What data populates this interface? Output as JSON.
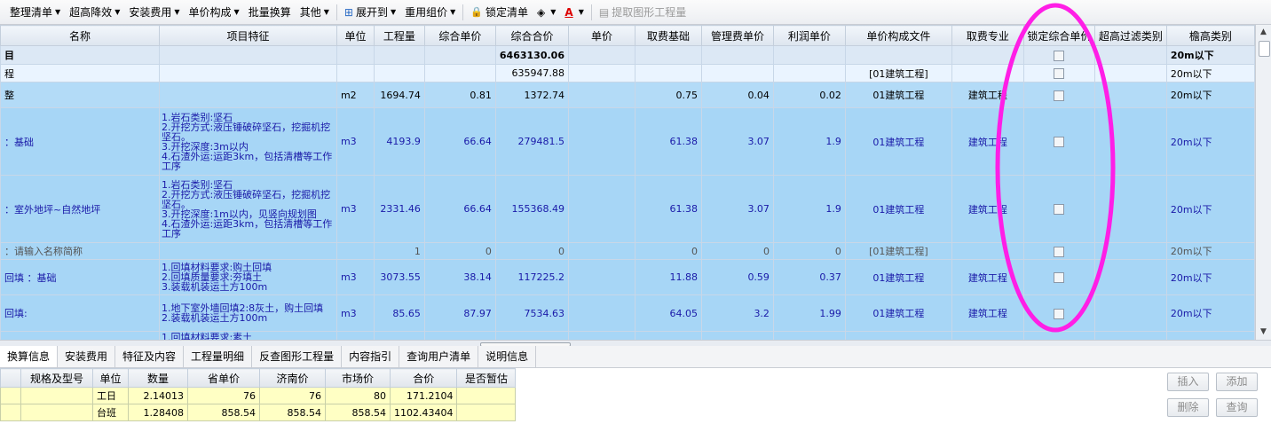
{
  "toolbar": {
    "items": [
      {
        "label": "整理清单",
        "caret": true
      },
      {
        "label": "超高降效",
        "caret": true
      },
      {
        "label": "安装费用",
        "caret": true
      },
      {
        "label": "单价构成",
        "caret": true
      },
      {
        "label": "批量换算",
        "caret": false
      },
      {
        "label": "其他",
        "caret": true
      },
      {
        "label": "展开到",
        "caret": true,
        "icon": "expand-tree-icon"
      },
      {
        "label": "重用组价",
        "caret": true
      },
      {
        "label": "锁定清单",
        "caret": false,
        "icon": "lock-icon"
      },
      {
        "label": "",
        "caret": true,
        "icon": "paint-bucket-icon"
      },
      {
        "label": "",
        "caret": true,
        "icon": "font-color-icon"
      },
      {
        "label": "提取图形工程量",
        "caret": false,
        "icon": "extract-graphic-icon",
        "disabled": true
      }
    ]
  },
  "grid": {
    "columns": [
      "名称",
      "项目特征",
      "单位",
      "工程量",
      "综合单价",
      "综合合价",
      "单价",
      "取费基础",
      "管理费单价",
      "利润单价",
      "单价构成文件",
      "取费专业",
      "锁定综合单价",
      "超高过滤类别",
      "檐高类别"
    ],
    "rows": [
      {
        "type": "total",
        "cells": [
          "目",
          "",
          "",
          "",
          "",
          "6463130.06",
          "",
          "",
          "",
          "",
          "",
          "",
          "",
          "",
          "20m以下"
        ],
        "check": true
      },
      {
        "type": "sec",
        "cells": [
          "程",
          "",
          "",
          "",
          "",
          "635947.88",
          "",
          "",
          "",
          "",
          "[01建筑工程]",
          "",
          "",
          "",
          "20m以下"
        ],
        "check": true
      },
      {
        "type": "sel",
        "cells": [
          "整",
          "",
          "m2",
          "1694.74",
          "0.81",
          "1372.74",
          "",
          "0.75",
          "0.04",
          "0.02",
          "01建筑工程",
          "建筑工程",
          "",
          "",
          "20m以下"
        ],
        "check": true
      },
      {
        "type": "item",
        "cells": [
          "：基础",
          "1.岩石类别:坚石\n2.开挖方式:液压锤破碎坚石，挖掘机挖坚石。\n3.开挖深度:3m以内\n4.石渣外运:运距3km，包括清槽等工作工序",
          "m3",
          "4193.9",
          "66.64",
          "279481.5",
          "",
          "61.38",
          "3.07",
          "1.9",
          "01建筑工程",
          "建筑工程",
          "",
          "",
          "20m以下"
        ],
        "check": true
      },
      {
        "type": "item",
        "cells": [
          "：室外地坪~自然地坪",
          "1.岩石类别:坚石\n2.开挖方式:液压锤破碎坚石，挖掘机挖坚石。\n3.开挖深度:1m以内，见竖向规划图\n4.石渣外运:运距3km，包括清槽等工作工序",
          "m3",
          "2331.46",
          "66.64",
          "155368.49",
          "",
          "61.38",
          "3.07",
          "1.9",
          "01建筑工程",
          "建筑工程",
          "",
          "",
          "20m以下"
        ],
        "check": true
      },
      {
        "type": "empty",
        "cells": [
          "：请输入名称简称",
          "",
          "",
          "1",
          "0",
          "0",
          "",
          "0",
          "0",
          "0",
          "[01建筑工程]",
          "",
          "",
          "",
          "20m以下"
        ],
        "check": true
      },
      {
        "type": "item",
        "cells": [
          "回填 ：基础",
          "1.回填材料要求:购土回填\n2.回填质量要求:夯填土\n3.装载机装运土方100m",
          "m3",
          "3073.55",
          "38.14",
          "117225.2",
          "",
          "11.88",
          "0.59",
          "0.37",
          "01建筑工程",
          "建筑工程",
          "",
          "",
          "20m以下"
        ],
        "check": true
      },
      {
        "type": "item",
        "cells": [
          "回填:",
          "1.地下室外墙回填2:8灰土，购土回填\n2.装载机装运土方100m",
          "m3",
          "85.65",
          "87.97",
          "7534.63",
          "",
          "64.05",
          "3.2",
          "1.99",
          "01建筑工程",
          "建筑工程",
          "",
          "",
          "20m以下"
        ],
        "check": true
      },
      {
        "type": "partial",
        "cells": [
          "",
          "1.回填材料要求:素土",
          "",
          "",
          "",
          "",
          "",
          "",
          "",
          "",
          "",
          "",
          "",
          "",
          ""
        ],
        "check": false
      }
    ]
  },
  "bottom_tabs": [
    "换算信息",
    "安装费用",
    "特征及内容",
    "工程量明细",
    "反查图形工程量",
    "内容指引",
    "查询用户清单",
    "说明信息"
  ],
  "detail": {
    "columns": [
      "",
      "规格及型号",
      "单位",
      "数量",
      "省单价",
      "济南价",
      "市场价",
      "合价",
      "是否暂估"
    ],
    "rows": [
      [
        "",
        "",
        "工日",
        "2.14013",
        "76",
        "76",
        "80",
        "171.2104",
        ""
      ],
      [
        "",
        "",
        "台班",
        "1.28408",
        "858.54",
        "858.54",
        "858.54",
        "1102.43404",
        ""
      ]
    ]
  },
  "side_buttons": {
    "insert": "插入",
    "add": "添加",
    "delete": "删除",
    "query": "查询"
  },
  "annotation": {
    "color": "#ff1ee6"
  }
}
